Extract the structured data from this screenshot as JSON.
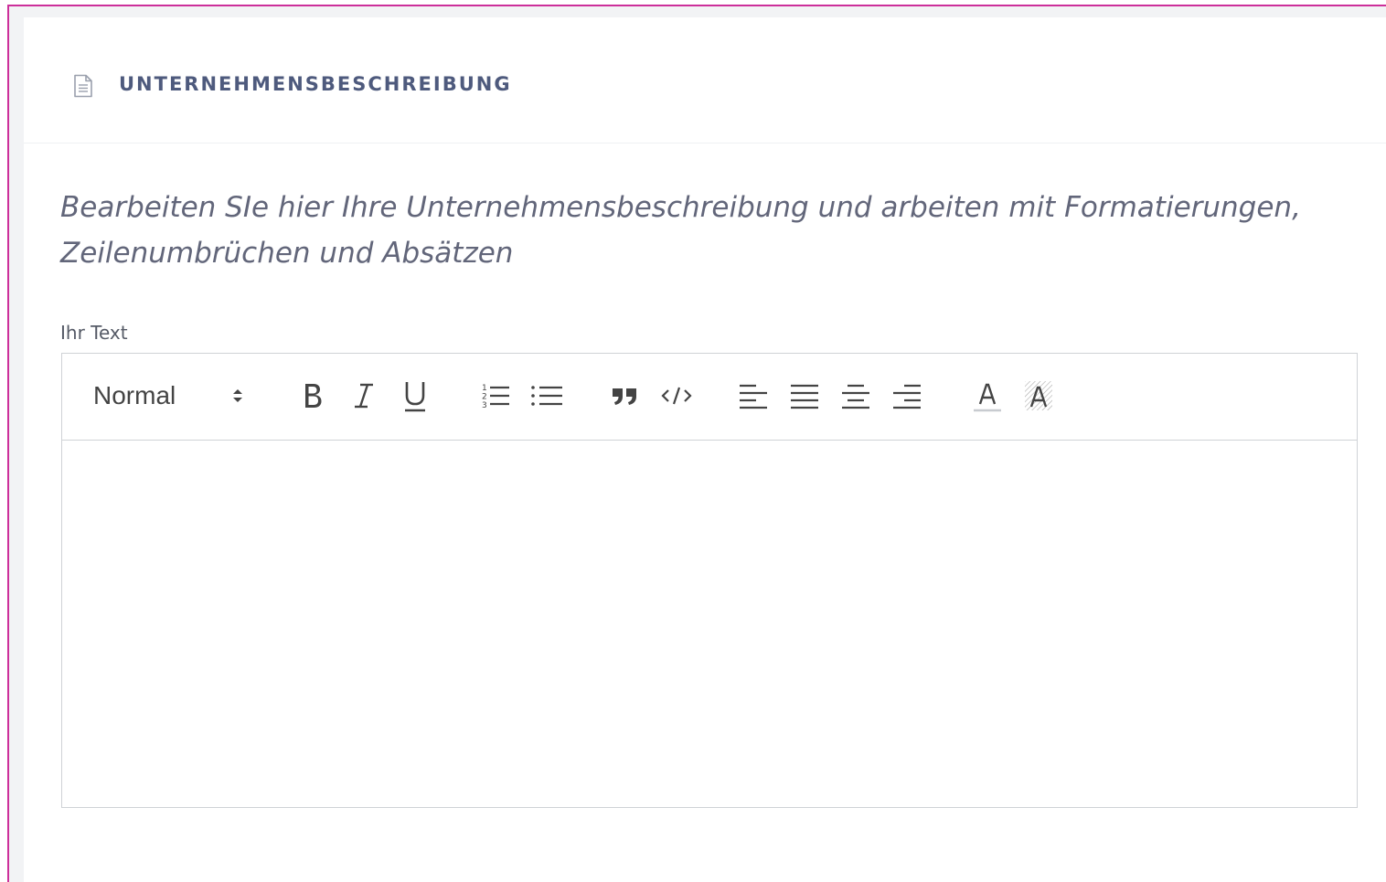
{
  "section": {
    "icon": "document-icon",
    "title": "UNTERNEHMENSBESCHREIBUNG"
  },
  "intro_text": "Bearbeiten SIe hier Ihre Unternehmensbeschreibung und arbeiten mit Formatierungen, Zeilenumbrüchen und Absätzen",
  "editor": {
    "label": "Ihr Text",
    "format_select": {
      "selected": "Normal"
    },
    "toolbar": [
      {
        "name": "bold",
        "icon": "bold-icon"
      },
      {
        "name": "italic",
        "icon": "italic-icon"
      },
      {
        "name": "underline",
        "icon": "underline-icon"
      },
      {
        "name": "ordered-list",
        "icon": "ordered-list-icon"
      },
      {
        "name": "bullet-list",
        "icon": "bullet-list-icon"
      },
      {
        "name": "blockquote",
        "icon": "quote-icon"
      },
      {
        "name": "code-block",
        "icon": "code-icon"
      },
      {
        "name": "align-left",
        "icon": "align-left-icon"
      },
      {
        "name": "align-justify",
        "icon": "align-justify-icon"
      },
      {
        "name": "align-center",
        "icon": "align-center-icon"
      },
      {
        "name": "align-right",
        "icon": "align-right-icon"
      },
      {
        "name": "text-color",
        "icon": "text-color-icon"
      },
      {
        "name": "background-color",
        "icon": "background-color-icon"
      }
    ],
    "content": ""
  },
  "colors": {
    "accent_border": "#cc2f9a",
    "header_title": "#4e5a7d",
    "intro_text": "#62667a",
    "toolbar_icon": "#444444"
  }
}
